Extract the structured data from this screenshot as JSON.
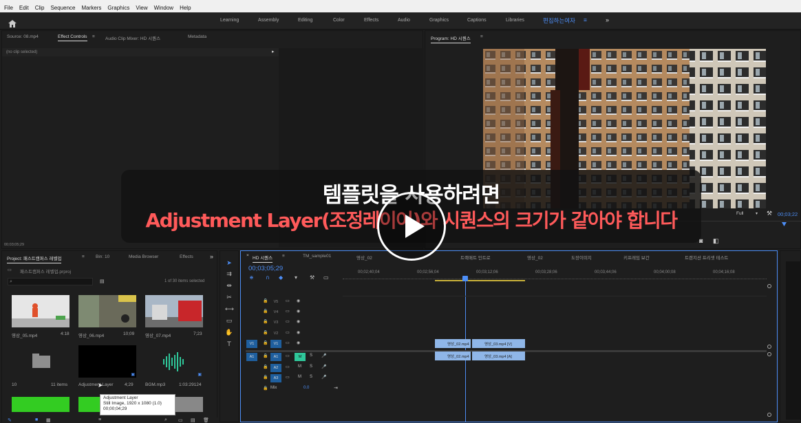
{
  "menu": [
    "File",
    "Edit",
    "Clip",
    "Sequence",
    "Markers",
    "Graphics",
    "View",
    "Window",
    "Help"
  ],
  "workspaces": {
    "items": [
      "Learning",
      "Assembly",
      "Editing",
      "Color",
      "Effects",
      "Audio",
      "Graphics",
      "Captions",
      "Libraries"
    ],
    "active": "편집하는여자"
  },
  "source_panel": {
    "tabs": [
      "Source: 08.mp4",
      "Effect Controls",
      "Audio Clip Mixer: HD 시퀀스",
      "Metadata"
    ],
    "no_clip": "(no clip selected)",
    "timecode": "00;03;05;29"
  },
  "program": {
    "title": "Program: HD 시퀀스",
    "zoom": "Full",
    "timecode": "00;03;22"
  },
  "project": {
    "tabs": [
      "Project: 패스트캠퍼스 레벨업",
      "Bin: 10",
      "Media Browser",
      "Effects"
    ],
    "file": "패스트캠퍼스 레벨업.prproj",
    "selected": "1 of 30 items selected",
    "items": [
      {
        "name": "영상_05.mp4",
        "duration": "4:18"
      },
      {
        "name": "영상_06.mp4",
        "duration": "10;09"
      },
      {
        "name": "영상_07.mp4",
        "duration": "7;23"
      },
      {
        "name": "10",
        "duration": "11 items"
      },
      {
        "name": "Adjustment Layer",
        "duration": "4;29"
      },
      {
        "name": "BGM.mp3",
        "duration": "1:03:29124"
      }
    ],
    "tooltip": [
      "Adjustment Layer",
      "Still Image, 1920 x 1080 (1.0)",
      "00;00;04;29"
    ]
  },
  "timeline": {
    "tabs": [
      "HD 시퀀스",
      "TM_sample01",
      "영상_02",
      "트랙매트 인트로",
      "영상_02",
      "도장이미지",
      "키프레임 보간",
      "트랜지션 프리셋 테스트"
    ],
    "playhead": "00;03;05;29",
    "ruler": [
      "00;02;40;04",
      "00;02;56;04",
      "00;03;12;06",
      "00;03;28;06",
      "00;03;44;06",
      "00;04;00;08",
      "00;04;16;08"
    ],
    "video_tracks": [
      "V5",
      "V4",
      "V3",
      "V2",
      "V1"
    ],
    "audio_tracks": [
      "A1",
      "A2",
      "A3"
    ],
    "mix_label": "Mix",
    "mix_value": "0.0",
    "clips": {
      "v1a": "영상_02.mp4",
      "v1b": "영상_03.mp4 [V]",
      "a1a": "영상_02.mp4",
      "a1b": "영상_03.mp4 [A]"
    }
  },
  "subtitle": {
    "line1": "템플릿을 사용하려면",
    "line2": "Adjustment Layer(조정레이어)와 시퀀스의 크기가 같아야 합니다"
  },
  "colors": {
    "accent": "#4d8ef6",
    "subtitle_red": "#ff5a5a",
    "clip_video": "#8fb6e8",
    "clip_audio": "#8fb6e8",
    "track_blue": "#1f5f9e"
  }
}
